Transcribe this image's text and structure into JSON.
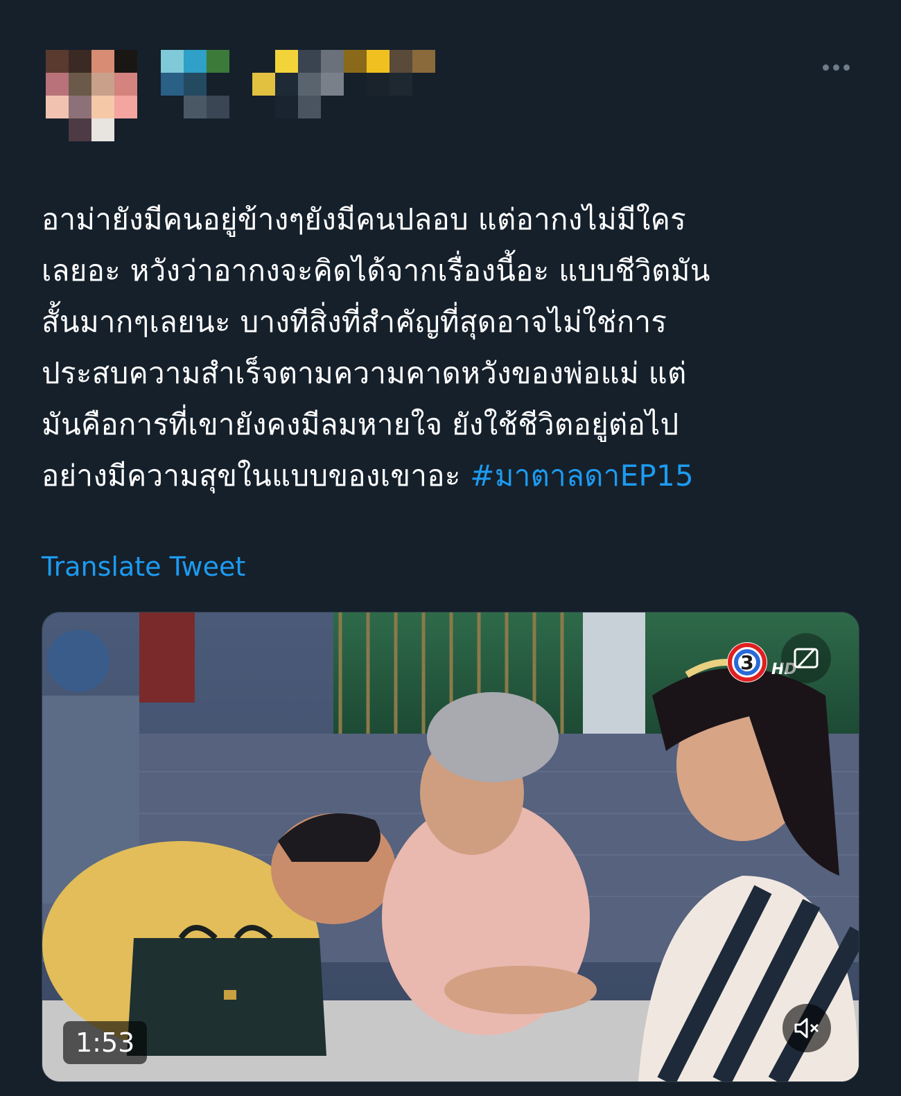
{
  "tweet": {
    "author": {
      "avatar": "pixelated-avatar",
      "name": "",
      "handle": ""
    },
    "menu_icon": "more-horizontal-icon",
    "text_lines": [
      "อาม่ายังมีคนอยู่ข้างๆยังมีคนปลอบ แต่อากงไม่มีใคร",
      "เลยอะ หวังว่าอากงจะคิดได้จากเรื่องนี้อะ แบบชีวิตมัน",
      "สั้นมากๆเลยนะ บางทีสิ่งที่สำคัญที่สุดอาจไม่ใช่การ",
      "ประสบความสำเร็จตามความคาดหวังของพ่อแม่ แต่",
      "มันคือการที่เขายังคงมีลมหายใจ ยังใช้ชีวิตอยู่ต่อไป",
      "อย่างมีความสุขในแบบของเขาอะ "
    ],
    "hashtag": "#มาตาลดาEP15",
    "translate_label": "Translate Tweet",
    "media": {
      "type": "video",
      "duration": "1:53",
      "channel_logo_text": "3",
      "channel_hd_text": "HD",
      "captions_icon": "closed-captions-icon",
      "mute_icon": "speaker-muted-icon"
    }
  },
  "colors": {
    "background": "#15202b",
    "text": "#ffffff",
    "link": "#1d9bf0"
  }
}
